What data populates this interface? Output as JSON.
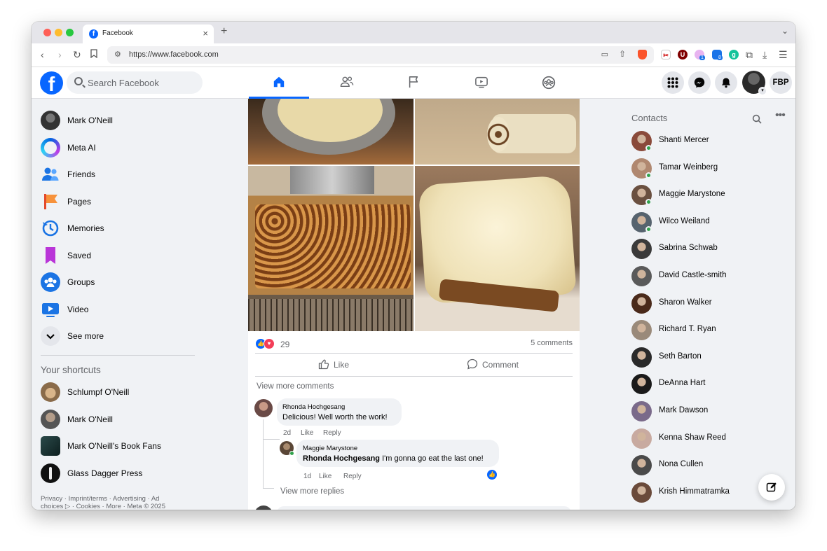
{
  "browser": {
    "tab_title": "Facebook",
    "url": "https://www.facebook.com",
    "extension_badges": [
      "1",
      "8"
    ]
  },
  "header": {
    "logo": "f",
    "search_placeholder": "Search Facebook",
    "nav_tabs": [
      "home-icon",
      "friends-icon",
      "pages-icon",
      "video-icon",
      "groups-icon"
    ],
    "active_tab": "home",
    "profile_initials": "FBP"
  },
  "left_nav": {
    "items": [
      {
        "label": "Mark O'Neill",
        "icon": "profile-avatar"
      },
      {
        "label": "Meta AI",
        "icon": "meta-ai-icon"
      },
      {
        "label": "Friends",
        "icon": "friends-icon"
      },
      {
        "label": "Pages",
        "icon": "pages-flag-icon"
      },
      {
        "label": "Memories",
        "icon": "memories-clock-icon"
      },
      {
        "label": "Saved",
        "icon": "saved-bookmark-icon"
      },
      {
        "label": "Groups",
        "icon": "groups-icon"
      },
      {
        "label": "Video",
        "icon": "video-icon"
      },
      {
        "label": "See more",
        "icon": "chevron-down-icon"
      }
    ],
    "shortcuts_title": "Your shortcuts",
    "shortcuts": [
      {
        "label": "Schlumpf O'Neill"
      },
      {
        "label": "Mark O'Neill"
      },
      {
        "label": "Mark O'Neill's Book Fans"
      },
      {
        "label": "Glass Dagger Press"
      }
    ],
    "footer_line1": "Privacy · Imprint/terms · Advertising · Ad",
    "footer_line2": "choices ▷ · Cookies · More · Meta © 2025"
  },
  "post": {
    "reaction_count": "29",
    "comment_count": "5 comments",
    "like_label": "Like",
    "comment_label": "Comment",
    "view_more_comments": "View more comments",
    "comments": [
      {
        "author": "Rhonda Hochgesang",
        "text": "Delicious! Well worth the work!",
        "time": "2d",
        "like": "Like",
        "reply": "Reply"
      }
    ],
    "reply": {
      "author": "Maggie Marystone",
      "mention": "Rhonda Hochgesang",
      "text": " I'm gonna go eat the last one!",
      "time": "1d",
      "like": "Like",
      "reply": "Reply"
    },
    "view_more_replies": "View more replies"
  },
  "contacts": {
    "title": "Contacts",
    "list": [
      {
        "name": "Shanti Mercer",
        "online": true
      },
      {
        "name": "Tamar Weinberg",
        "online": true
      },
      {
        "name": "Maggie Marystone",
        "online": true
      },
      {
        "name": "Wilco Weiland",
        "online": true
      },
      {
        "name": "Sabrina Schwab",
        "online": false
      },
      {
        "name": "David Castle-smith",
        "online": false
      },
      {
        "name": "Sharon Walker",
        "online": false
      },
      {
        "name": "Richard T. Ryan",
        "online": false
      },
      {
        "name": "Seth Barton",
        "online": false
      },
      {
        "name": "DeAnna Hart",
        "online": false
      },
      {
        "name": "Mark Dawson",
        "online": false
      },
      {
        "name": "Kenna Shaw Reed",
        "online": false
      },
      {
        "name": "Nona Cullen",
        "online": false
      },
      {
        "name": "Krish Himmatramka",
        "online": false
      }
    ]
  },
  "colors": {
    "brand_blue": "#0866ff",
    "online_green": "#31a24c",
    "background": "#f0f2f5"
  }
}
